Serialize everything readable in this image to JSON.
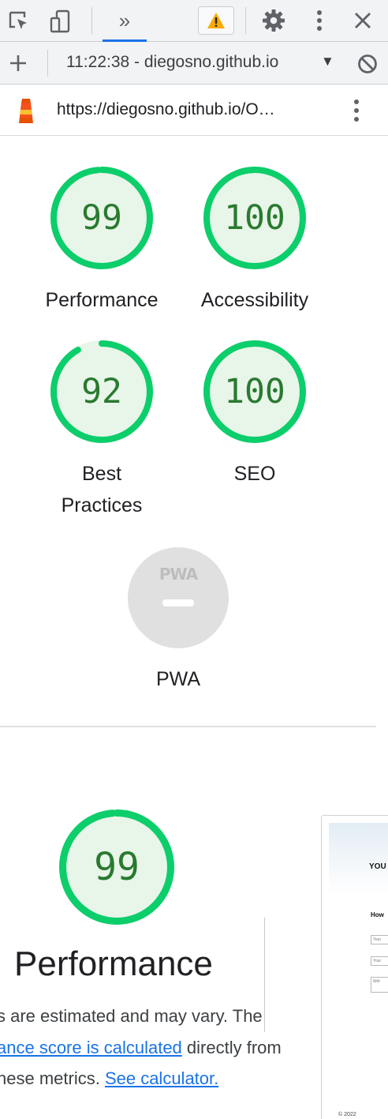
{
  "toolbar": {
    "inspect_icon": "element-picker-icon",
    "device_icon": "device-toolbar-icon",
    "more_tabs_label": "»",
    "warning_icon": "warning-icon",
    "settings_icon": "gear-icon",
    "menu_icon": "kebab-menu-icon",
    "close_icon": "close-icon"
  },
  "report_bar": {
    "add_icon": "plus-icon",
    "report_title": "11:22:38 - diegosno.github.io",
    "caret": "▼",
    "clear_icon": "block-icon"
  },
  "url_bar": {
    "logo_icon": "lighthouse-icon",
    "url": "https://diegosno.github.io/O…",
    "menu_icon": "kebab-menu-icon"
  },
  "scores": [
    {
      "label": "Performance",
      "value": "99",
      "score": 99
    },
    {
      "label": "Accessibility",
      "value": "100",
      "score": 100
    },
    {
      "label_line1": "Best",
      "label_line2": "Practices",
      "value": "92",
      "score": 92
    },
    {
      "label": "SEO",
      "value": "100",
      "score": 100
    }
  ],
  "pwa": {
    "logo_text": "PWA",
    "label": "PWA"
  },
  "performance": {
    "score": 99,
    "value": "99",
    "title": "Performance",
    "line1": "s are estimated and may vary. The",
    "line2_link": "ance score is calculated",
    "line2_rest": " directly from",
    "line3_text": "hese metrics. ",
    "line3_link": "See calculator."
  },
  "thumbnail": {
    "heading": "YOU",
    "subheading": "How",
    "field1": "Your",
    "field2": "Your",
    "field3": "Writ",
    "footer": "© 2022"
  },
  "colors": {
    "pass_stroke": "#0cce6b",
    "pass_fill": "#e8f5e9",
    "pass_text": "#297a2f",
    "link": "#1a73e8",
    "pwa_gray": "#e0e0e0"
  }
}
